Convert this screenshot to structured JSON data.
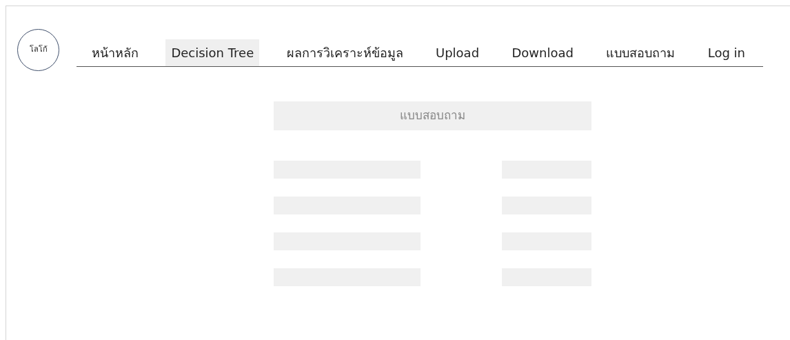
{
  "logo": {
    "text": "โลโก้"
  },
  "nav": [
    {
      "label": "หน้าหลัก",
      "selected": false
    },
    {
      "label": "Decision Tree",
      "selected": true
    },
    {
      "label": "ผลการวิเคราะห์ข้อมูล",
      "selected": false
    },
    {
      "label": "Upload",
      "selected": false
    },
    {
      "label": "Download",
      "selected": false
    },
    {
      "label": "แบบสอบถาม",
      "selected": false
    },
    {
      "label": "Log in",
      "selected": false
    }
  ],
  "form": {
    "title": "แบบสอบถาม",
    "rows": [
      {
        "kind": "pair"
      },
      {
        "kind": "pair"
      },
      {
        "kind": "pair"
      },
      {
        "kind": "pair"
      }
    ]
  }
}
